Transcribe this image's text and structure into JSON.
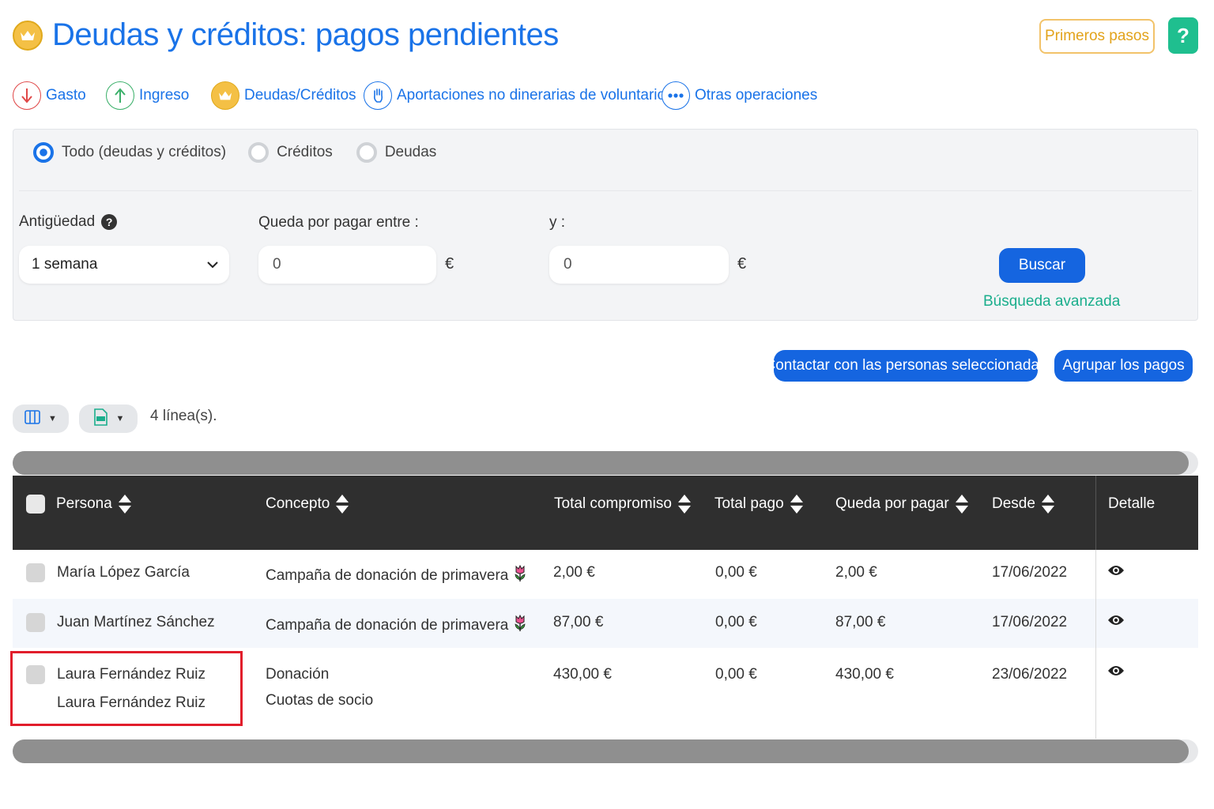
{
  "header": {
    "title": "Deudas y créditos: pagos pendientes",
    "primeros_pasos": "Primeros pasos",
    "help": "?"
  },
  "nav": {
    "gasto": "Gasto",
    "ingreso": "Ingreso",
    "deudas": "Deudas/Créditos",
    "aportaciones": "Aportaciones no dinerarias de voluntarios",
    "otras": "Otras operaciones"
  },
  "filters": {
    "radio_todo": "Todo (deudas y créditos)",
    "radio_creditos": "Créditos",
    "radio_deudas": "Deudas",
    "selected": "todo",
    "antiguedad_label": "Antigüedad",
    "antiguedad_value": "1 semana",
    "queda_label": "Queda por pagar entre :",
    "min_value": "0",
    "y_label": "y :",
    "max_value": "0",
    "currency": "€",
    "buscar": "Buscar",
    "busqueda_avanzada": "Búsqueda avanzada"
  },
  "actions": {
    "contactar": "Contactar con las personas seleccionadas",
    "agrupar": "Agrupar los pagos"
  },
  "toolbar": {
    "line_count": "4 línea(s)."
  },
  "table": {
    "headers": {
      "persona": "Persona",
      "concepto": "Concepto",
      "total_compromiso": "Total compromiso",
      "total_pago": "Total pago",
      "queda_por_pagar": "Queda por pagar",
      "desde": "Desde",
      "detalle": "Detalle"
    },
    "rows": [
      {
        "persona": "María López García",
        "concepto": "Campaña de donación de primavera",
        "total_compromiso": "2,00 €",
        "total_pago": "0,00 €",
        "queda": "2,00 €",
        "desde": "17/06/2022"
      },
      {
        "persona": "Juan Martínez Sánchez",
        "concepto": "Campaña de donación de primavera",
        "total_compromiso": "87,00 €",
        "total_pago": "0,00 €",
        "queda": "87,00 €",
        "desde": "17/06/2022"
      },
      {
        "persona": "Laura Fernández Ruiz",
        "persona_2": "Laura Fernández Ruiz",
        "concepto": "Donación",
        "concepto_2": "Cuotas de socio",
        "total_compromiso": "430,00 €",
        "total_pago": "0,00 €",
        "queda": "430,00 €",
        "desde": "23/06/2022"
      }
    ]
  },
  "colors": {
    "primary_blue": "#1a73e8",
    "button_blue": "#1565e0",
    "green": "#1aae8c",
    "gold": "#e2a31b",
    "header_dark": "#2f2f2f",
    "highlight_red": "#e11d2b"
  }
}
